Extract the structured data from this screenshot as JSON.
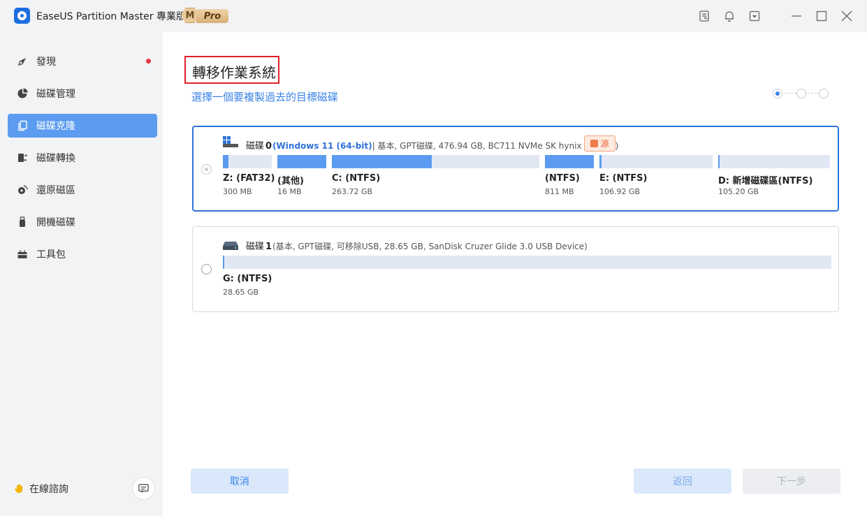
{
  "app": {
    "title": "EaseUS Partition Master 專業版",
    "badge_letter": "M",
    "badge_label": "Pro"
  },
  "titlebar_icons": [
    "notes-icon",
    "bell-icon",
    "dropdown-icon",
    "minimize-icon",
    "maximize-icon",
    "close-icon"
  ],
  "sidebar": {
    "items": [
      {
        "label": "發現",
        "icon": "compass-icon",
        "active": false,
        "has_dot": true
      },
      {
        "label": "磁碟管理",
        "icon": "pie-icon",
        "active": false
      },
      {
        "label": "磁碟克隆",
        "icon": "clone-icon",
        "active": true
      },
      {
        "label": "磁碟轉換",
        "icon": "convert-icon",
        "active": false
      },
      {
        "label": "還原磁區",
        "icon": "restore-icon",
        "active": false
      },
      {
        "label": "開機磁碟",
        "icon": "usb-icon",
        "active": false
      },
      {
        "label": "工具包",
        "icon": "toolbox-icon",
        "active": false
      }
    ],
    "consult_label": "在線諮詢"
  },
  "page": {
    "title": "轉移作業系統",
    "subtitle": "選擇一個要複製過去的目標磁碟",
    "step_current": 1,
    "step_total": 3
  },
  "disks": [
    {
      "name": "磁碟",
      "number": "0",
      "os": "(Windows 11 (64-bit)",
      "details": " | 基本, GPT磁碟, 476.94 GB, BC711 NVMe SK hynix 512GB )",
      "tag": "源",
      "selected": true,
      "partitions": [
        {
          "name": "Z: (FAT32)",
          "size": "300 MB",
          "used_fraction": 0.12
        },
        {
          "name": "(其他)",
          "size": "16 MB",
          "used_fraction": 1.0
        },
        {
          "name": "C: (NTFS)",
          "size": "263.72 GB",
          "used_fraction": 0.48
        },
        {
          "name": "(NTFS)",
          "size": "811 MB",
          "used_fraction": 1.0
        },
        {
          "name": "E: (NTFS)",
          "size": "106.92 GB",
          "used_fraction": 0.02
        },
        {
          "name": "D: 新增磁碟區(NTFS)",
          "size": "105.20 GB",
          "used_fraction": 0.01
        }
      ]
    },
    {
      "name": "磁碟",
      "number": "1",
      "details": "(基本, GPT磁碟, 可移除USB, 28.65 GB, SanDisk Cruzer Glide 3.0 USB Device)",
      "selected": false,
      "partitions": [
        {
          "name": "G: (NTFS)",
          "size": "28.65 GB",
          "used_fraction": 0.002
        }
      ]
    }
  ],
  "buttons": {
    "cancel": "取消",
    "back": "返回",
    "next": "下一步"
  },
  "colors": {
    "accent": "#3a83e6",
    "selection_border": "#2f72d9",
    "bar_fill": "#5b9cf0",
    "bar_empty": "#e1e8f4",
    "source_tag": "#e8693a",
    "highlight_box": "#e0202a"
  }
}
